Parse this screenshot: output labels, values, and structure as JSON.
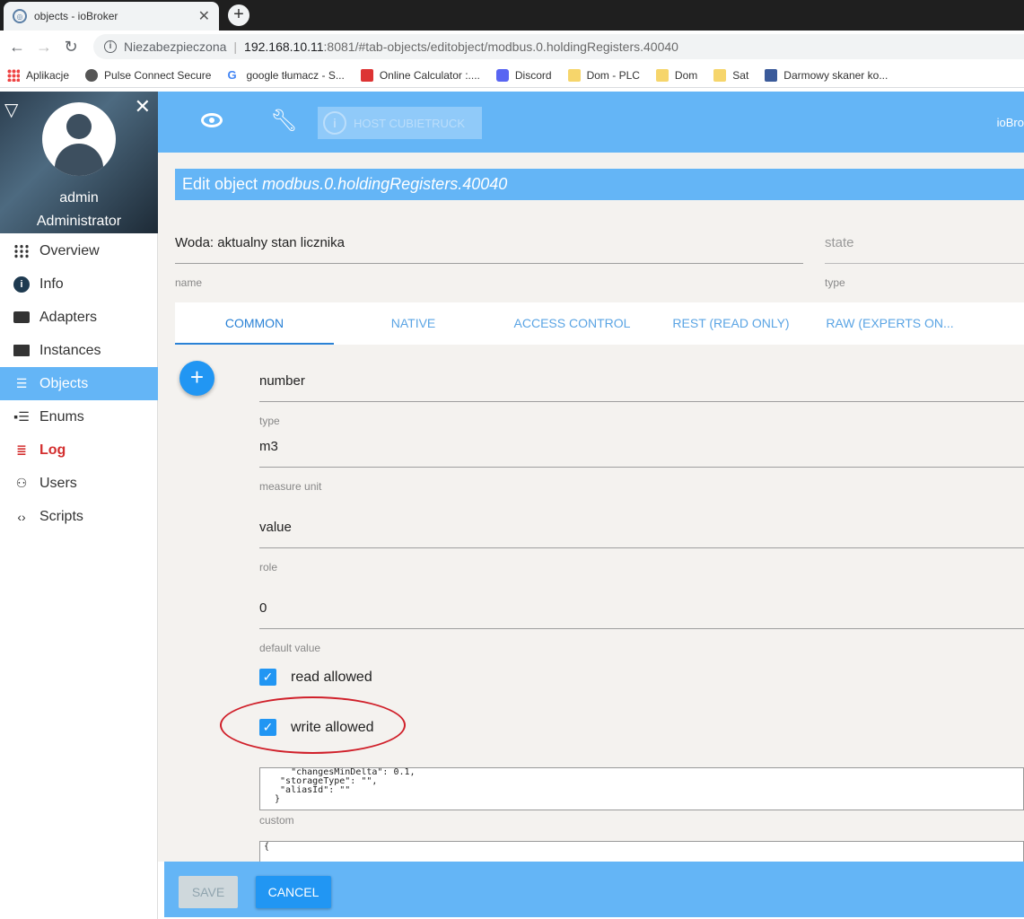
{
  "browser": {
    "tab_title": "objects - ioBroker",
    "close": "✕",
    "newtab": "+",
    "insecure": "Niezabezpieczona",
    "url_host": "192.168.10.11",
    "url_rest": ":8081/#tab-objects/editobject/modbus.0.holdingRegisters.40040",
    "bookmarks": [
      {
        "label": "Aplikacje",
        "icon": "apps-icon"
      },
      {
        "label": "Pulse Connect Secure",
        "icon": "globe-icon"
      },
      {
        "label": "google tłumacz - S...",
        "icon": "google-icon"
      },
      {
        "label": "Online Calculator :....",
        "icon": "calculator-icon"
      },
      {
        "label": "Discord",
        "icon": "discord-icon"
      },
      {
        "label": "Dom - PLC",
        "icon": "folder-icon"
      },
      {
        "label": "Dom",
        "icon": "folder-icon"
      },
      {
        "label": "Sat",
        "icon": "folder-icon"
      },
      {
        "label": "Darmowy skaner ko...",
        "icon": "scanner-icon"
      }
    ]
  },
  "profile": {
    "username": "admin",
    "role": "Administrator"
  },
  "menu": [
    {
      "label": "Overview",
      "icon": "grid-icon"
    },
    {
      "label": "Info",
      "icon": "info-icon"
    },
    {
      "label": "Adapters",
      "icon": "store-icon"
    },
    {
      "label": "Instances",
      "icon": "instances-icon"
    },
    {
      "label": "Objects",
      "icon": "list-icon",
      "active": true
    },
    {
      "label": "Enums",
      "icon": "enums-icon"
    },
    {
      "label": "Log",
      "icon": "log-icon"
    },
    {
      "label": "Users",
      "icon": "user-icon"
    },
    {
      "label": "Scripts",
      "icon": "code-icon"
    }
  ],
  "appbar": {
    "host_label": "HOST CUBIETRUCK",
    "brand": "ioBro"
  },
  "editor": {
    "header_prefix": "Edit object ",
    "object_id": "modbus.0.holdingRegisters.40040",
    "name_value": "Woda: aktualny stan licznika",
    "name_label": "name",
    "type_value": "state",
    "type_label": "type",
    "tabs": [
      "COMMON",
      "NATIVE",
      "ACCESS CONTROL",
      "REST (READ ONLY)",
      "RAW (EXPERTS ON..."
    ],
    "common": {
      "type_value": "number",
      "type_label": "type",
      "unit_value": "m3",
      "unit_label": "measure unit",
      "role_value": "value",
      "role_label": "role",
      "default_value": "0",
      "default_label": "default value",
      "read_label": "read allowed",
      "write_label": "write allowed",
      "custom_text": "    \"changesMinDelta\": 0.1,\n  \"storageType\": \"\",\n  \"aliasId\": \"\"\n }",
      "custom_label": "custom",
      "custom2_text": "{"
    }
  },
  "buttons": {
    "save": "SAVE",
    "cancel": "CANCEL"
  }
}
